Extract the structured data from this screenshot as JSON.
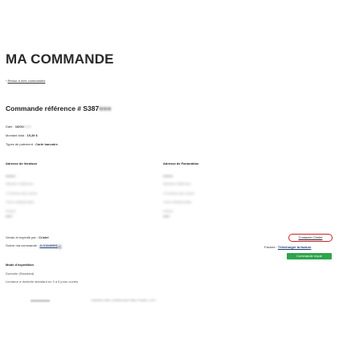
{
  "page": {
    "title": "MA COMMANDE",
    "back_link": "Retour à mes commandes",
    "back_arrow": "‹"
  },
  "order": {
    "reference_label": "Commande référence # S387",
    "reference_masked": "■■■",
    "date_label": "Date :",
    "date_value": "16/01/",
    "date_masked": "2024",
    "total_label": "Montant total :",
    "total_value": "19,39 €",
    "payment_label": "Types de paiement :",
    "payment_value": "Carte bancaire"
  },
  "addresses": {
    "shipping_title": "Adresse de livraison",
    "billing_title": "Adresse de Facturation",
    "shipping_lines": [
      "▬▬▬",
      "Sylvaine Vuillermoz",
      "72 chemin des roches",
      "74473 VANSICHEN",
      "France",
      "▬▬"
    ],
    "billing_lines": [
      "▬▬▬",
      "Sylvaine Vuillermoz",
      "72 chemin des roches",
      "74473 VANSICHEN",
      "France",
      "▬▬"
    ]
  },
  "seller": {
    "sold_label": "Vendu et expédié par :",
    "sold_value": "Cristel",
    "tracking_label": "Suivre ma commande :",
    "tracking_value": "2L01840391",
    "tracking_masked": "■■",
    "contact_button": "Contacter Cristel",
    "invoice_label": "Facture :",
    "invoice_link": "Télécharger la facture",
    "status_badge": "Commande reçue"
  },
  "shipping": {
    "title": "Mode d'expédition",
    "method": "Domicile (Standard)",
    "detail": "Livraison à domicile standard en 3 à 5 jours ouvrés"
  },
  "product": {
    "name": "Cafetière filtre multifonction Bleu Pastel 1.25 L"
  },
  "colors": {
    "accent_red": "#c8242b",
    "status_green": "#2ea54c",
    "link_blue": "#1d3d6e"
  }
}
